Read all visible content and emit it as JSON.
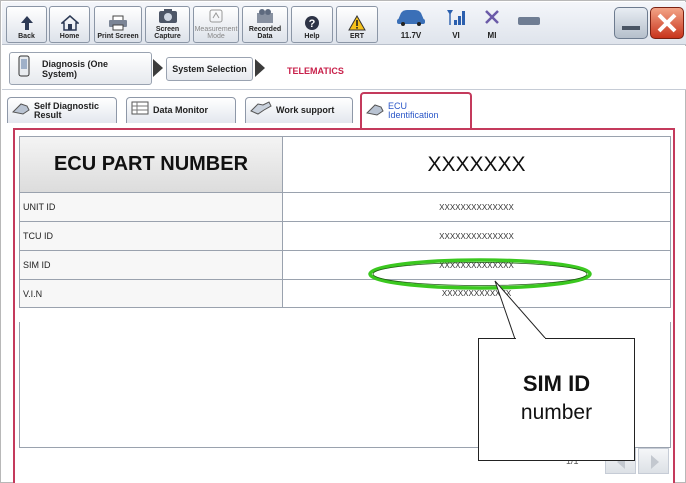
{
  "toolbar": {
    "buttons": [
      {
        "label": "Back",
        "icon": "back-arrow-icon"
      },
      {
        "label": "Home",
        "icon": "home-icon"
      },
      {
        "label": "Print Screen",
        "icon": "printer-icon"
      },
      {
        "label": "Screen\nCapture",
        "icon": "camera-icon"
      },
      {
        "label": "Measurement\nMode",
        "icon": "measurement-icon"
      },
      {
        "label": "Recorded\nData",
        "icon": "recorded-data-icon"
      },
      {
        "label": "Help",
        "icon": "help-icon"
      },
      {
        "label": "ERT",
        "icon": "warning-icon"
      }
    ],
    "status": [
      {
        "label": "11.7V",
        "icon": "vehicle-battery-icon"
      },
      {
        "label": "VI",
        "icon": "signal-icon"
      },
      {
        "label": "MI",
        "icon": "mi-x-icon"
      }
    ]
  },
  "breadcrumb": {
    "diagnosis": "Diagnosis (One\nSystem)",
    "system_selection": "System Selection",
    "current": "TELEMATICS"
  },
  "tabs": [
    {
      "label": "Self Diagnostic\nResult"
    },
    {
      "label": "Data Monitor"
    },
    {
      "label": "Work support"
    },
    {
      "label": "ECU\nIdentification"
    }
  ],
  "table": {
    "header": {
      "label": "ECU PART NUMBER",
      "value": "XXXXXXX"
    },
    "rows": [
      {
        "label": "UNIT ID",
        "value": "XXXXXXXXXXXXXX"
      },
      {
        "label": "TCU ID",
        "value": "XXXXXXXXXXXXXX"
      },
      {
        "label": "SIM ID",
        "value": "XXXXXXXXXXXXXX"
      },
      {
        "label": "V.I.N",
        "value": "XXXXXXXXXXXXX"
      }
    ]
  },
  "paging": "1/1",
  "callout": {
    "title": "SIM ID",
    "subtitle": "number"
  },
  "colors": {
    "active_tab": "#c43a5c",
    "highlight": "#3bc81f",
    "telematics": "#c8204a"
  }
}
